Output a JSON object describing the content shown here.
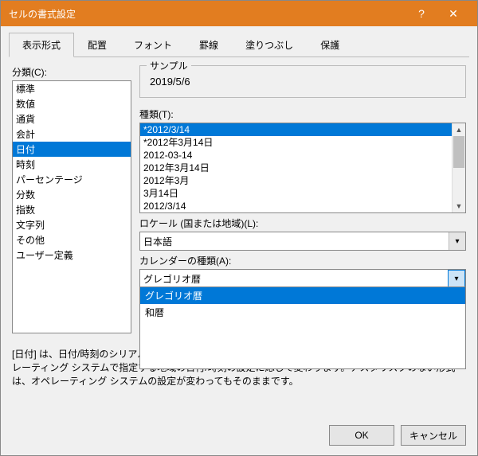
{
  "window": {
    "title": "セルの書式設定",
    "help": "?",
    "close": "✕"
  },
  "tabs": [
    "表示形式",
    "配置",
    "フォント",
    "罫線",
    "塗りつぶし",
    "保護"
  ],
  "active_tab": 0,
  "category": {
    "label": "分類(C):",
    "items": [
      "標準",
      "数値",
      "通貨",
      "会計",
      "日付",
      "時刻",
      "パーセンテージ",
      "分数",
      "指数",
      "文字列",
      "その他",
      "ユーザー定義"
    ],
    "selected": 4
  },
  "sample": {
    "label": "サンプル",
    "value": "2019/5/6"
  },
  "type": {
    "label": "種類(T):",
    "items": [
      "*2012/3/14",
      "*2012年3月14日",
      "2012-03-14",
      "2012年3月14日",
      "2012年3月",
      "3月14日",
      "2012/3/14"
    ],
    "selected": 0
  },
  "locale": {
    "label": "ロケール (国または地域)(L):",
    "value": "日本語"
  },
  "calendar": {
    "label": "カレンダーの種類(A):",
    "value": "グレゴリオ暦",
    "options": [
      "グレゴリオ暦",
      "和暦"
    ],
    "selected": 0
  },
  "description": "[日付] は、日付/時刻のシリアル値を日付形式で表示します。アスタリスク (*) で始まる日付形式は、オペレーティング システムで指定する地域の日付/時刻の設定に応じて変わります。アスタリスクのない形式は、オペレーティング システムの設定が変わってもそのままです。",
  "buttons": {
    "ok": "OK",
    "cancel": "キャンセル"
  }
}
